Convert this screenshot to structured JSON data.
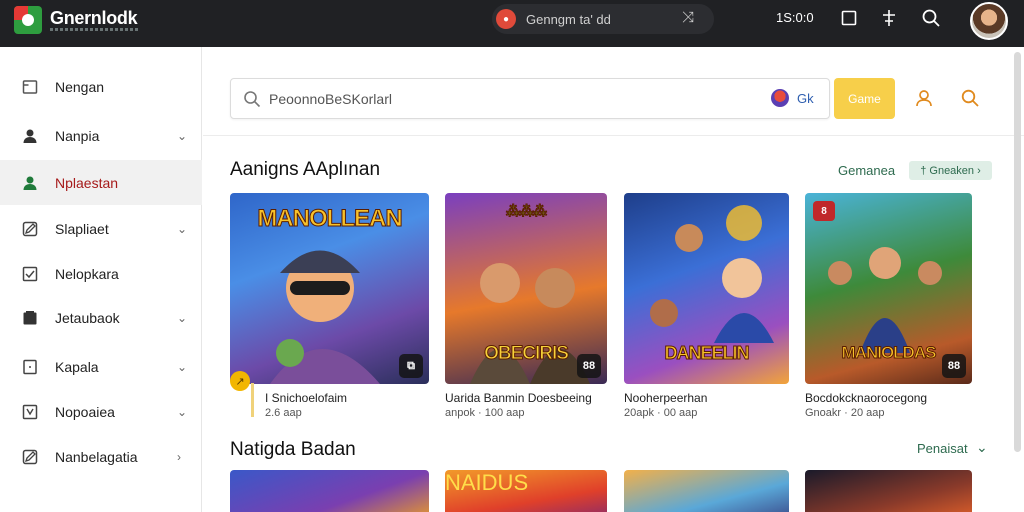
{
  "topbar": {
    "brand": "Gnernlodk",
    "center_text": "Genngm ta' dd",
    "count": "1S:0:0"
  },
  "sidebar": {
    "items": [
      {
        "label": "Nengan",
        "icon": "window-icon",
        "chevron": false,
        "active": false
      },
      {
        "label": "Nanpia",
        "icon": "person-icon",
        "chevron": true,
        "active": false
      },
      {
        "label": "Nplaestan",
        "icon": "person-icon",
        "chevron": false,
        "active": true
      },
      {
        "label": "Slapliaet",
        "icon": "edit-icon",
        "chevron": true,
        "active": false
      },
      {
        "label": "Nelopkara",
        "icon": "checkbox-icon",
        "chevron": false,
        "active": false
      },
      {
        "label": "Jetaubaok",
        "icon": "folder-icon",
        "chevron": true,
        "active": false
      },
      {
        "label": "Kapala",
        "icon": "square-icon",
        "chevron": true,
        "active": false
      },
      {
        "label": "Nopoaiea",
        "icon": "checkbox-icon",
        "chevron": true,
        "active": false
      },
      {
        "label": "Nanbelagatia",
        "icon": "edit-icon",
        "chevron": true,
        "active": false
      }
    ]
  },
  "search": {
    "placeholder": "PeoonnoBeSKorlarl",
    "ok_label": "Gk",
    "button_label": "Game"
  },
  "section1": {
    "title": "Aanigns AAplınan",
    "link": "Gemanea",
    "chip": "† Gneaken ›"
  },
  "cards": [
    {
      "art_title": "MANOLLEAN",
      "badge": "⧉",
      "caption": "I Snichoelofaim",
      "sub": "2.6 aap"
    },
    {
      "art_title": "OBECIRIS",
      "badge": "88",
      "caption": "Uarida Banmin Doesbeeing",
      "sub": "anpok · 100 aap"
    },
    {
      "art_title": "DANEELIN",
      "badge": "",
      "caption": "Nooherpeerhan",
      "sub": "20apk · 00 aap"
    },
    {
      "art_title": "MANIOLDAS",
      "badge": "88",
      "caption": "Bocdokcknaorocegong",
      "sub": "Gnoakr · 20 aap"
    }
  ],
  "section2": {
    "title": "Natigda Badan",
    "link": "Penaisat"
  },
  "row2": [
    {
      "art_title": ""
    },
    {
      "art_title": "NAIDUS"
    },
    {
      "art_title": ""
    },
    {
      "art_title": ""
    }
  ],
  "colors": {
    "topbar": "#202124",
    "accent_yellow": "#f7cf4a",
    "active_text": "#a61a1a",
    "link_green": "#2e6b4f"
  }
}
